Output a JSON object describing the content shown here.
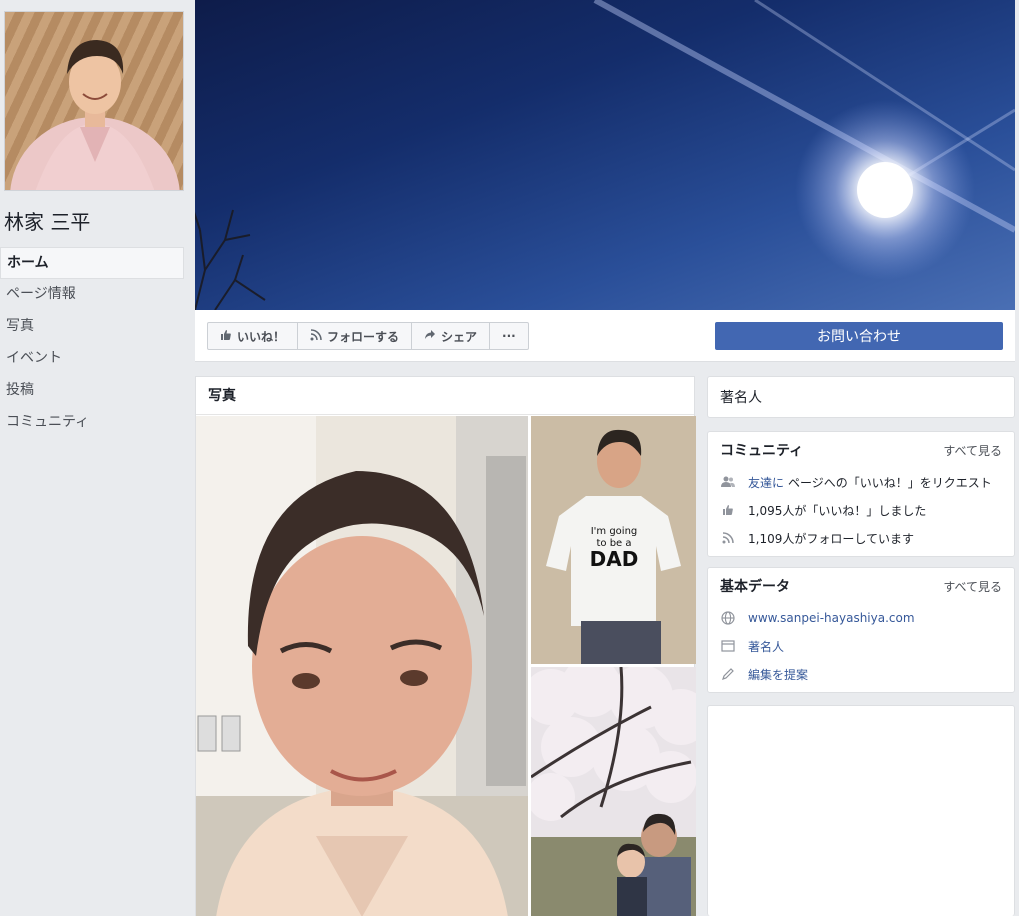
{
  "page": {
    "name": "林家 三平",
    "category": "著名人"
  },
  "nav": {
    "items": [
      {
        "label": "ホーム"
      },
      {
        "label": "ページ情報"
      },
      {
        "label": "写真"
      },
      {
        "label": "イベント"
      },
      {
        "label": "投稿"
      },
      {
        "label": "コミュニティ"
      }
    ]
  },
  "actions": {
    "like": "いいね！",
    "follow": "フォローする",
    "share": "シェア",
    "more": "···",
    "contact": "お問い合わせ"
  },
  "photos": {
    "title": "写真",
    "shirt_text_1": "I'm going",
    "shirt_text_2": "to be a",
    "shirt_text_3": "DAD"
  },
  "community": {
    "title": "コミュニティ",
    "see_all": "すべて見る",
    "invite_link": "友達に",
    "invite_text": "ページへの「いいね！」をリクエスト",
    "likes": "1,095人が「いいね！」しました",
    "follows": "1,109人がフォローしています"
  },
  "about": {
    "title": "基本データ",
    "see_all": "すべて見る",
    "website": "www.sanpei-hayashiya.com",
    "category": "著名人",
    "suggest": "編集を提案"
  },
  "colors": {
    "brand": "#4267b2",
    "link": "#365899",
    "background": "#e9ebee"
  }
}
